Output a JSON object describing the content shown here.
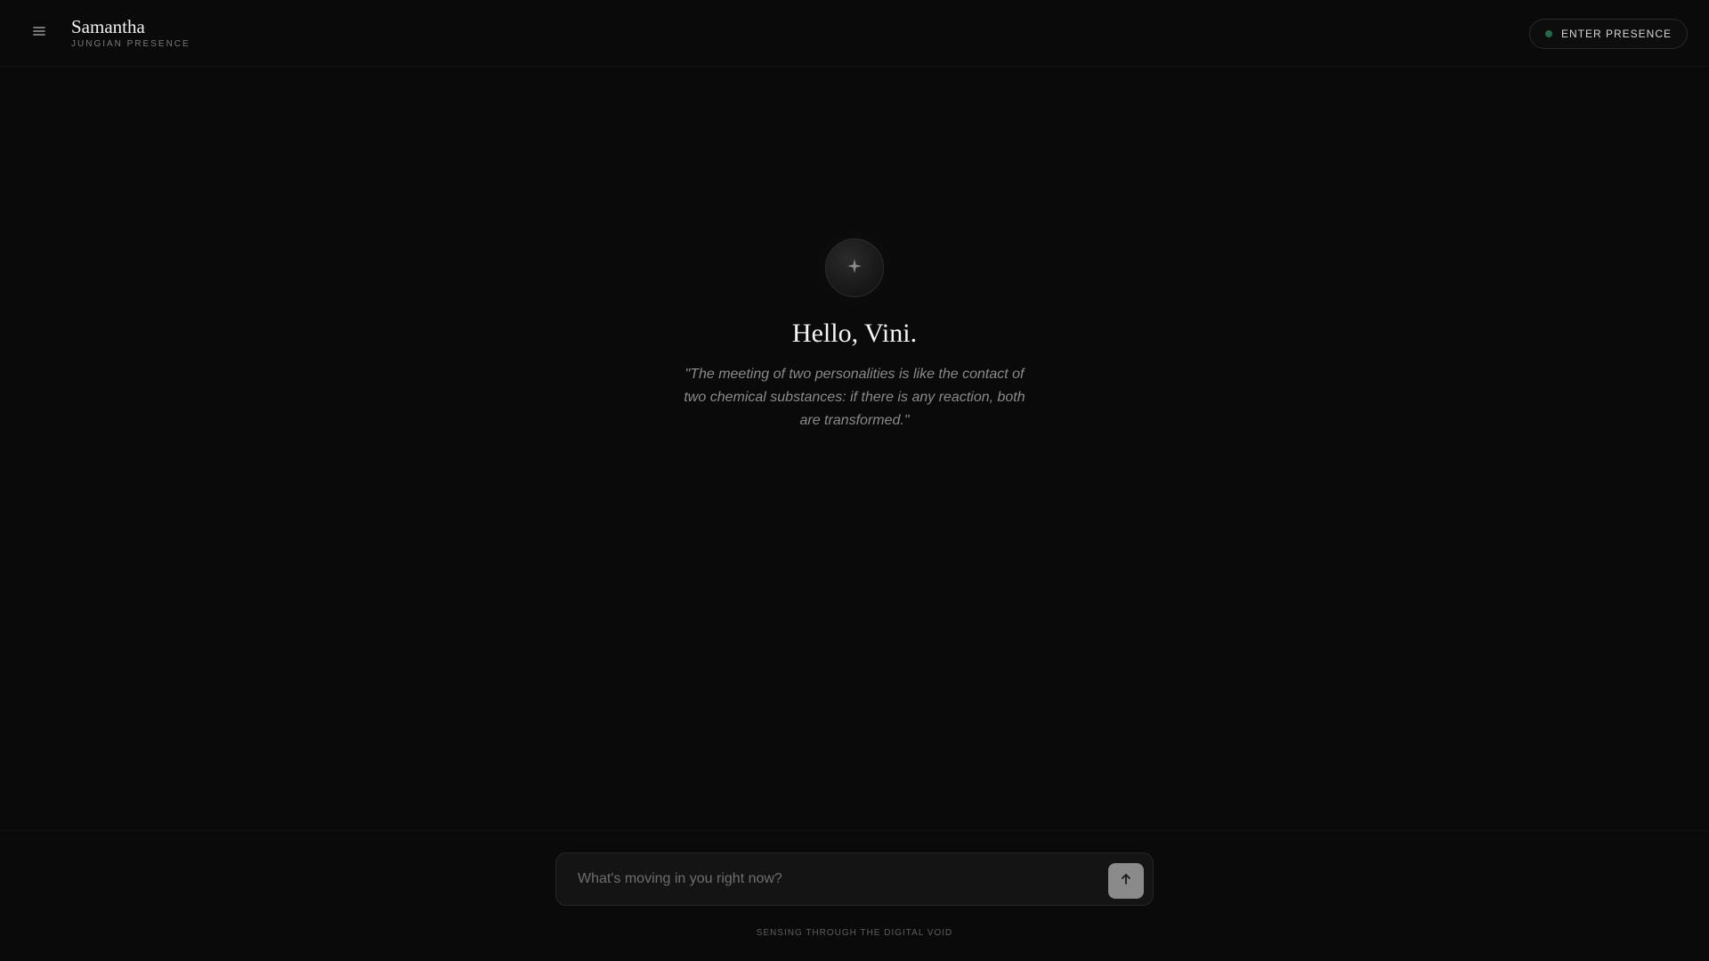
{
  "header": {
    "menu_icon": "menu-icon",
    "title": "Samantha",
    "subtitle": "JUNGIAN PRESENCE",
    "presence_button": "ENTER PRESENCE",
    "presence_status_color": "#1f6b4a"
  },
  "main": {
    "orb_icon": "sparkle-icon",
    "greeting": "Hello, Vini.",
    "quote": "\"The meeting of two personalities is like the contact of two chemical substances: if there is any reaction, both are transformed.\""
  },
  "composer": {
    "placeholder": "What's moving in you right now?",
    "value": "",
    "send_icon": "send-icon"
  },
  "footer": {
    "note": "SENSING THROUGH THE DIGITAL VOID"
  }
}
